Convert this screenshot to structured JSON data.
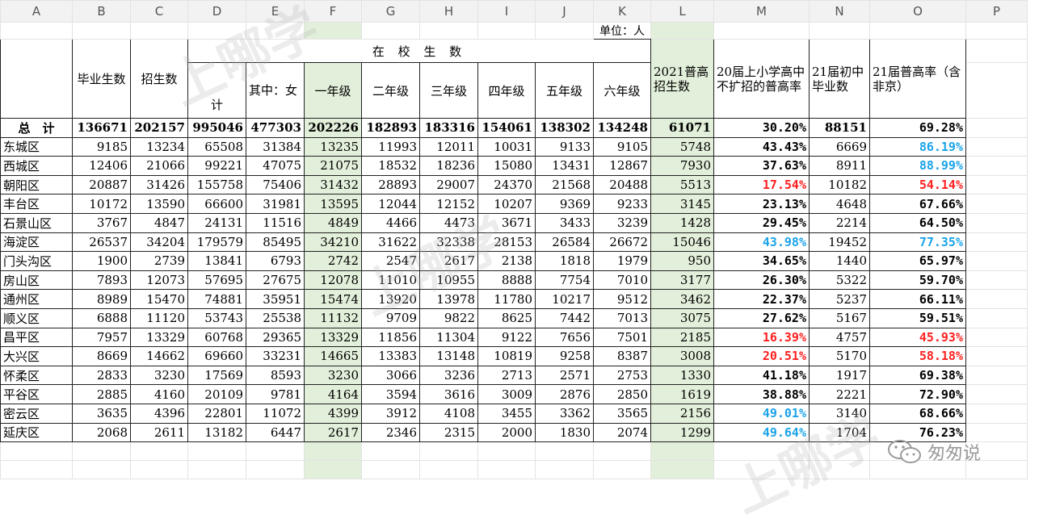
{
  "columns": [
    "A",
    "B",
    "C",
    "D",
    "E",
    "F",
    "G",
    "H",
    "I",
    "J",
    "K",
    "L",
    "M",
    "N",
    "O",
    "P"
  ],
  "unit_label": "单位：人",
  "header": {
    "grad": "毕业生数",
    "enroll": "招生数",
    "in_school": "在 校 生 数",
    "total": "计",
    "female": "其中：女",
    "grade1": "一年级",
    "grade2": "二年级",
    "grade3": "三年级",
    "grade4": "四年级",
    "grade5": "五年级",
    "grade6": "六年级",
    "hs2021": "2021普高招生数",
    "rate20": "20届上小学高中不扩招的普高率",
    "jr21": "21届初中毕业数",
    "rate21": "21届普高率（含非京）"
  },
  "total_row": {
    "name": "总　计",
    "values": [
      "136671",
      "202157",
      "995046",
      "477303",
      "202226",
      "182893",
      "183316",
      "154061",
      "138302",
      "134248",
      "61071",
      "30.20%",
      "88151",
      "69.28%"
    ]
  },
  "rows": [
    {
      "name": "东城区",
      "values": [
        "9185",
        "13234",
        "65508",
        "31384",
        "13235",
        "11993",
        "12011",
        "10031",
        "9133",
        "9105",
        "5748",
        "43.43%",
        "6669",
        "86.19%"
      ],
      "m_color": "#000000",
      "o_color": "#1aa3e8"
    },
    {
      "name": "西城区",
      "values": [
        "12406",
        "21066",
        "99221",
        "47075",
        "21075",
        "18532",
        "18236",
        "15080",
        "13431",
        "12867",
        "7930",
        "37.63%",
        "8911",
        "88.99%"
      ],
      "m_color": "#000000",
      "o_color": "#1aa3e8"
    },
    {
      "name": "朝阳区",
      "values": [
        "20887",
        "31426",
        "155758",
        "75406",
        "31432",
        "28893",
        "29007",
        "24370",
        "21568",
        "20488",
        "5513",
        "17.54%",
        "10182",
        "54.14%"
      ],
      "m_color": "#ff2020",
      "o_color": "#ff2020"
    },
    {
      "name": "丰台区",
      "values": [
        "10172",
        "13590",
        "66600",
        "31981",
        "13595",
        "12044",
        "12152",
        "10207",
        "9369",
        "9233",
        "3145",
        "23.13%",
        "4648",
        "67.66%"
      ],
      "m_color": "#000000",
      "o_color": "#000000"
    },
    {
      "name": "石景山区",
      "values": [
        "3767",
        "4847",
        "24131",
        "11516",
        "4849",
        "4466",
        "4473",
        "3671",
        "3433",
        "3239",
        "1428",
        "29.45%",
        "2214",
        "64.50%"
      ],
      "m_color": "#000000",
      "o_color": "#000000"
    },
    {
      "name": "海淀区",
      "values": [
        "26537",
        "34204",
        "179579",
        "85495",
        "34210",
        "31622",
        "32338",
        "28153",
        "26584",
        "26672",
        "15046",
        "43.98%",
        "19452",
        "77.35%"
      ],
      "m_color": "#1aa3e8",
      "o_color": "#1aa3e8"
    },
    {
      "name": "门头沟区",
      "values": [
        "1900",
        "2739",
        "13841",
        "6793",
        "2742",
        "2547",
        "2617",
        "2138",
        "1818",
        "1979",
        "950",
        "34.65%",
        "1440",
        "65.97%"
      ],
      "m_color": "#000000",
      "o_color": "#000000"
    },
    {
      "name": "房山区",
      "values": [
        "7893",
        "12073",
        "57695",
        "27675",
        "12078",
        "11010",
        "10955",
        "8888",
        "7754",
        "7010",
        "3177",
        "26.30%",
        "5322",
        "59.70%"
      ],
      "m_color": "#000000",
      "o_color": "#000000"
    },
    {
      "name": "通州区",
      "values": [
        "8989",
        "15470",
        "74881",
        "35951",
        "15474",
        "13920",
        "13978",
        "11780",
        "10217",
        "9512",
        "3462",
        "22.37%",
        "5237",
        "66.11%"
      ],
      "m_color": "#000000",
      "o_color": "#000000"
    },
    {
      "name": "顺义区",
      "values": [
        "6888",
        "11120",
        "53743",
        "25538",
        "11132",
        "9709",
        "9822",
        "8625",
        "7442",
        "7013",
        "3075",
        "27.62%",
        "5167",
        "59.51%"
      ],
      "m_color": "#000000",
      "o_color": "#000000"
    },
    {
      "name": "昌平区",
      "values": [
        "7957",
        "13329",
        "60768",
        "29365",
        "13329",
        "11856",
        "11304",
        "9122",
        "7656",
        "7501",
        "2185",
        "16.39%",
        "4757",
        "45.93%"
      ],
      "m_color": "#ff2020",
      "o_color": "#ff2020"
    },
    {
      "name": "大兴区",
      "values": [
        "8669",
        "14662",
        "69660",
        "33231",
        "14665",
        "13383",
        "13148",
        "10819",
        "9258",
        "8387",
        "3008",
        "20.51%",
        "5170",
        "58.18%"
      ],
      "m_color": "#ff2020",
      "o_color": "#ff2020"
    },
    {
      "name": "怀柔区",
      "values": [
        "2833",
        "3230",
        "17569",
        "8593",
        "3230",
        "3066",
        "3236",
        "2713",
        "2571",
        "2753",
        "1330",
        "41.18%",
        "1917",
        "69.38%"
      ],
      "m_color": "#000000",
      "o_color": "#000000"
    },
    {
      "name": "平谷区",
      "values": [
        "2885",
        "4160",
        "20109",
        "9781",
        "4164",
        "3594",
        "3616",
        "3009",
        "2876",
        "2850",
        "1619",
        "38.88%",
        "2221",
        "72.90%"
      ],
      "m_color": "#000000",
      "o_color": "#000000"
    },
    {
      "name": "密云区",
      "values": [
        "3635",
        "4396",
        "22801",
        "11072",
        "4399",
        "3912",
        "4108",
        "3455",
        "3362",
        "3565",
        "2156",
        "49.01%",
        "3140",
        "68.66%"
      ],
      "m_color": "#1aa3e8",
      "o_color": "#000000"
    },
    {
      "name": "延庆区",
      "values": [
        "2068",
        "2611",
        "13182",
        "6447",
        "2617",
        "2346",
        "2315",
        "2000",
        "1830",
        "2074",
        "1299",
        "49.64%",
        "1704",
        "76.23%"
      ],
      "m_color": "#1aa3e8",
      "o_color": "#000000"
    }
  ],
  "watermark": "上哪学",
  "logo_text": "匆匆说"
}
